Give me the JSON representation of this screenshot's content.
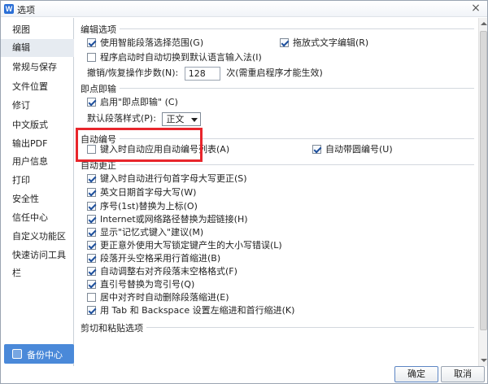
{
  "window": {
    "title": "选项",
    "app_icon": "W",
    "close_glyph": "×"
  },
  "sidebar": {
    "items": [
      {
        "label": "视图"
      },
      {
        "label": "编辑",
        "active": true
      },
      {
        "label": "常规与保存"
      },
      {
        "label": "文件位置"
      },
      {
        "label": "修订"
      },
      {
        "label": "中文版式"
      },
      {
        "label": "输出PDF"
      },
      {
        "label": "用户信息"
      },
      {
        "label": "打印"
      },
      {
        "label": "安全性"
      },
      {
        "label": "信任中心"
      },
      {
        "label": "自定义功能区"
      },
      {
        "label": "快速访问工具栏"
      }
    ],
    "backup_button": "备份中心"
  },
  "sections": {
    "edit_options": {
      "title": "编辑选项",
      "smart_paragraph": "使用智能段落选择范围(G)",
      "drag_text": "拖放式文字编辑(R)",
      "auto_ime": "程序启动时自动切换到默认语言输入法(I)",
      "undo_label": "撤销/恢复操作步数(N):",
      "undo_value": "128",
      "undo_suffix": "次(需重启程序才能生效)"
    },
    "click_to_type": {
      "title": "即点即输",
      "enable": "启用\"即点即输\" (C)",
      "default_style_label": "默认段落样式(P):",
      "default_style_value": "正文"
    },
    "auto_numbering": {
      "title": "自动编号",
      "apply_on_input": "键入时自动应用自动编号列表(A)",
      "auto_bullets": "自动带圆编号(U)"
    },
    "autocorrect": {
      "title": "自动更正",
      "items": [
        {
          "label": "键入时自动进行句首字母大写更正(S)",
          "checked": true
        },
        {
          "label": "英文日期首字母大写(W)",
          "checked": true
        },
        {
          "label": "序号(1st)替换为上标(O)",
          "checked": true
        },
        {
          "label": "Internet或网络路径替换为超链接(H)",
          "checked": true
        },
        {
          "label": "显示\"记忆式键入\"建议(M)",
          "checked": true
        },
        {
          "label": "更正意外使用大写锁定键产生的大小写错误(L)",
          "checked": true
        },
        {
          "label": "段落开头空格采用行首缩进(B)",
          "checked": true
        },
        {
          "label": "自动调整右对齐段落末空格格式(F)",
          "checked": true
        },
        {
          "label": "直引号替换为弯引号(Q)",
          "checked": true
        },
        {
          "label": "居中对齐时自动删除段落缩进(E)",
          "checked": false
        },
        {
          "label": "用 Tab 和 Backspace 设置左缩进和首行缩进(K)",
          "checked": true
        }
      ]
    },
    "cut_paste": {
      "title": "剪切和粘贴选项"
    }
  },
  "buttons": {
    "ok": "确定",
    "cancel": "取消"
  },
  "colors": {
    "highlight": "#e8262c",
    "accent": "#4a89d9",
    "sidebar_active": "#e6ebf1"
  }
}
